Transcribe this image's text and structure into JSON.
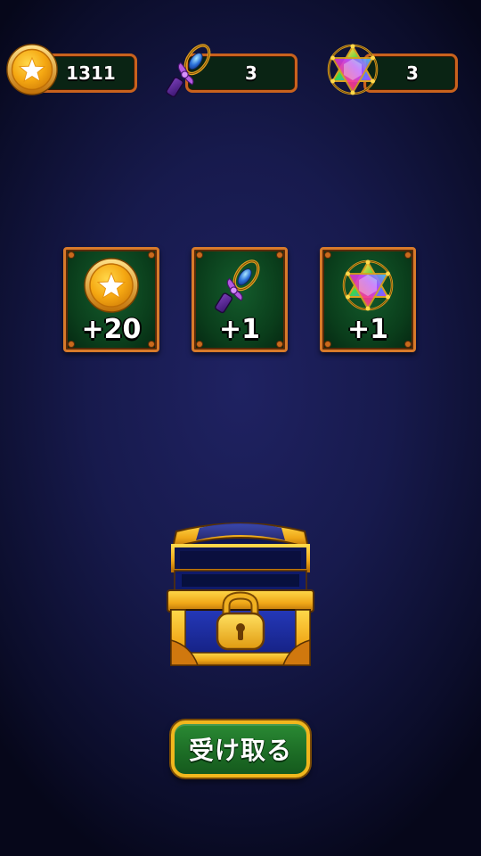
{
  "currencies": {
    "coins": {
      "value": "1311",
      "icon": "gold-coin-star-icon"
    },
    "wands": {
      "value": "3",
      "icon": "magic-wand-icon"
    },
    "stars": {
      "value": "3",
      "icon": "rainbow-hexagram-icon"
    }
  },
  "rewards": [
    {
      "id": "coins",
      "amount": "+20",
      "icon": "gold-coin-star-icon"
    },
    {
      "id": "wands",
      "amount": "+1",
      "icon": "magic-wand-icon"
    },
    {
      "id": "stars",
      "amount": "+1",
      "icon": "rainbow-hexagram-icon"
    }
  ],
  "chest": {
    "icon": "locked-treasure-chest-icon",
    "state": "open"
  },
  "claim_button": {
    "label": "受け取る"
  },
  "colors": {
    "counter_border": "#c9621d",
    "card_border": "#d77a2a",
    "card_bg": "#0a3d1b",
    "button_bg": "#1d6e26",
    "button_border": "#f1b71d",
    "chest_blue": "#1a2a9c",
    "chest_gold": "#f1b71d"
  }
}
